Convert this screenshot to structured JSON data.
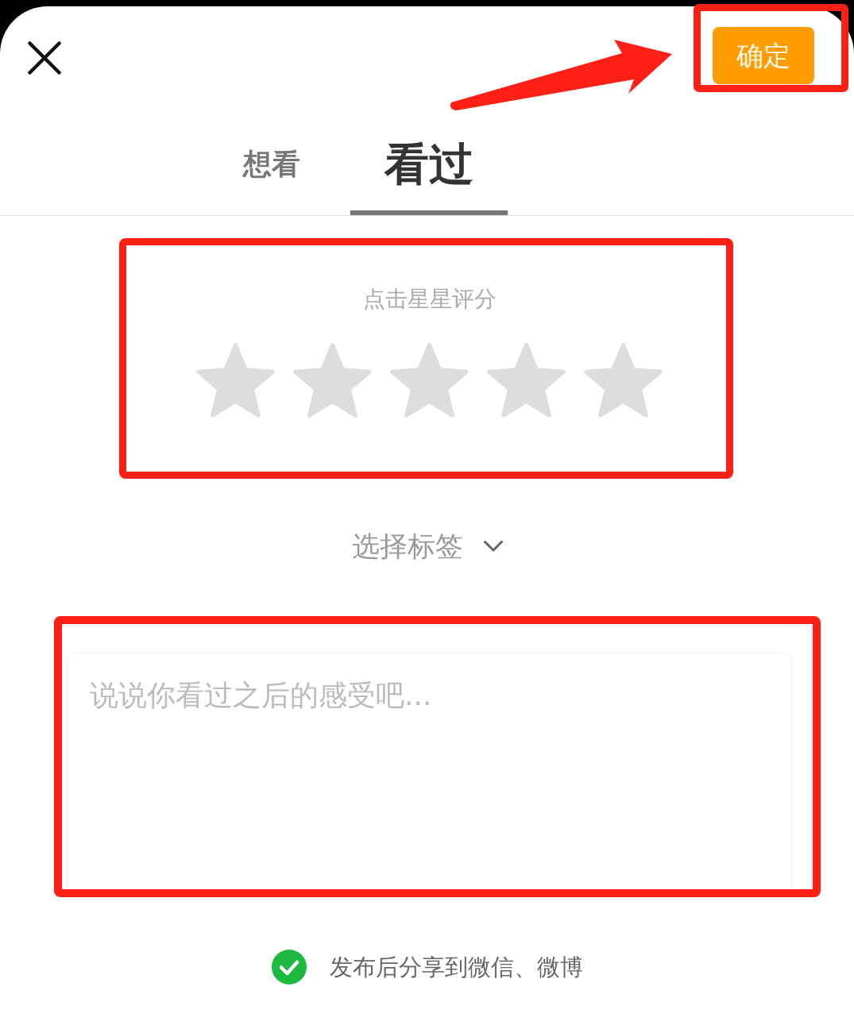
{
  "header": {
    "confirm_button": {
      "label": "确定",
      "annotation_frame": true,
      "annotation_arrow": true
    }
  },
  "tabs": [
    {
      "label": "想看",
      "selected": false
    },
    {
      "label": "看过",
      "selected": true
    }
  ],
  "rating": {
    "prompt": "点击星星评分",
    "stars": 0,
    "annotation_frame": true
  },
  "tag_selector": {
    "label": "选择标签"
  },
  "comment": {
    "placeholder": "说说你看过之后的感受吧...",
    "annotation_frame": true
  },
  "share": {
    "label": "发布后分享到微信、微博",
    "checked": true
  }
}
